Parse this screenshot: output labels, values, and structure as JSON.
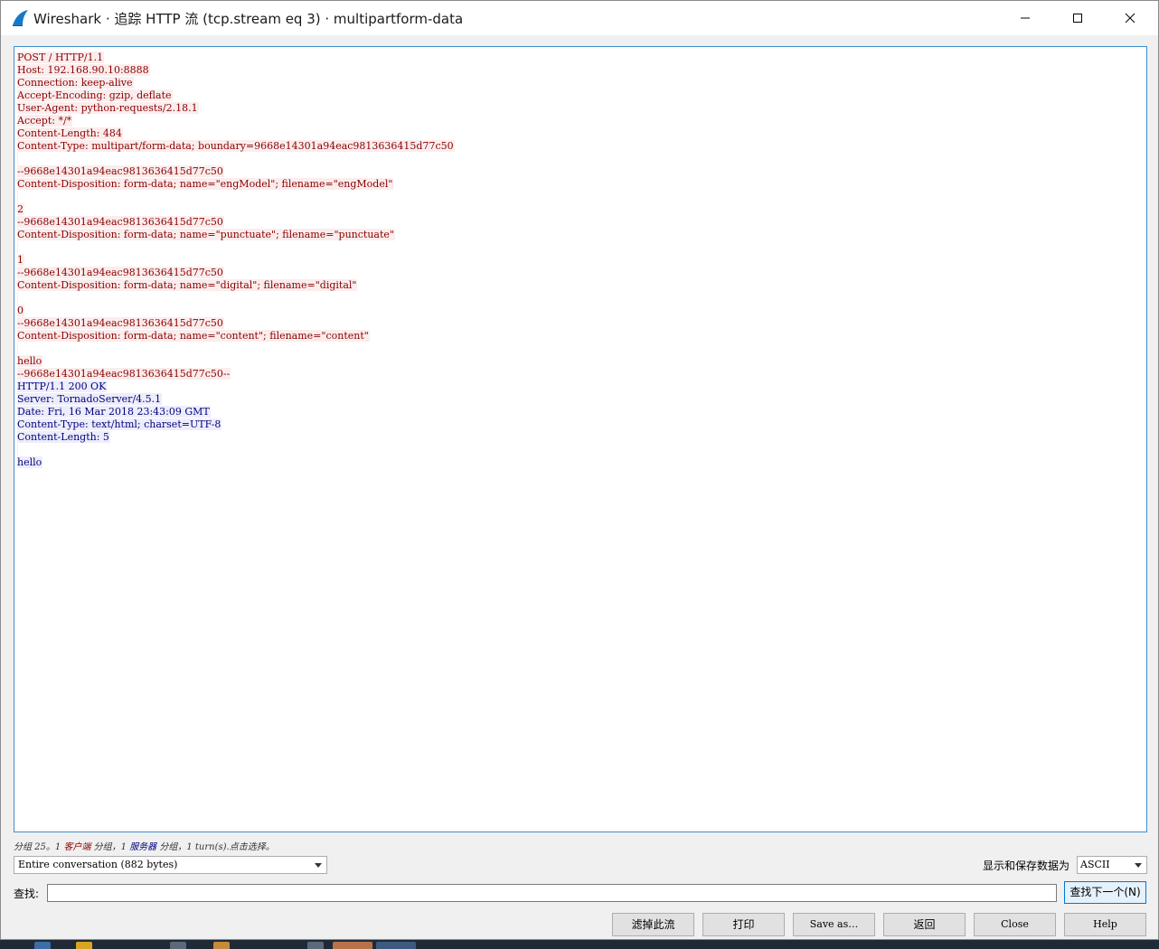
{
  "window": {
    "title": "Wireshark · 追踪 HTTP 流 (tcp.stream eq 3) · multipartform-data"
  },
  "icons": {
    "app": "wireshark-fin-icon",
    "minimize": "minimize-icon",
    "maximize": "maximize-icon",
    "close": "close-icon"
  },
  "colors": {
    "client_text": "#8b0000",
    "client_bg": "#fbeded",
    "server_text": "#000080",
    "server_bg": "#ededfb",
    "accent": "#0078d7"
  },
  "stream": {
    "lines": [
      {
        "text": "POST / HTTP/1.1",
        "side": "client"
      },
      {
        "text": "Host: 192.168.90.10:8888",
        "side": "client"
      },
      {
        "text": "Connection: keep-alive",
        "side": "client"
      },
      {
        "text": "Accept-Encoding: gzip, deflate",
        "side": "client"
      },
      {
        "text": "User-Agent: python-requests/2.18.1",
        "side": "client"
      },
      {
        "text": "Accept: */*",
        "side": "client"
      },
      {
        "text": "Content-Length: 484",
        "side": "client"
      },
      {
        "text": "Content-Type: multipart/form-data; boundary=9668e14301a94eac9813636415d77c50",
        "side": "client"
      },
      {
        "text": "",
        "side": "client"
      },
      {
        "text": "--9668e14301a94eac9813636415d77c50",
        "side": "client"
      },
      {
        "text": "Content-Disposition: form-data; name=\"engModel\"; filename=\"engModel\"",
        "side": "client"
      },
      {
        "text": "",
        "side": "client"
      },
      {
        "text": "2",
        "side": "client"
      },
      {
        "text": "--9668e14301a94eac9813636415d77c50",
        "side": "client"
      },
      {
        "text": "Content-Disposition: form-data; name=\"punctuate\"; filename=\"punctuate\"",
        "side": "client"
      },
      {
        "text": "",
        "side": "client"
      },
      {
        "text": "1",
        "side": "client"
      },
      {
        "text": "--9668e14301a94eac9813636415d77c50",
        "side": "client"
      },
      {
        "text": "Content-Disposition: form-data; name=\"digital\"; filename=\"digital\"",
        "side": "client"
      },
      {
        "text": "",
        "side": "client"
      },
      {
        "text": "0",
        "side": "client"
      },
      {
        "text": "--9668e14301a94eac9813636415d77c50",
        "side": "client"
      },
      {
        "text": "Content-Disposition: form-data; name=\"content\"; filename=\"content\"",
        "side": "client"
      },
      {
        "text": "",
        "side": "client"
      },
      {
        "text": "hello",
        "side": "client"
      },
      {
        "text": "--9668e14301a94eac9813636415d77c50--",
        "side": "client"
      },
      {
        "text": "HTTP/1.1 200 OK",
        "side": "server"
      },
      {
        "text": "Server: TornadoServer/4.5.1",
        "side": "server"
      },
      {
        "text": "Date: Fri, 16 Mar 2018 23:43:09 GMT",
        "side": "server"
      },
      {
        "text": "Content-Type: text/html; charset=UTF-8",
        "side": "server"
      },
      {
        "text": "Content-Length: 5",
        "side": "server"
      },
      {
        "text": "",
        "side": "server"
      },
      {
        "text": "hello",
        "side": "server"
      }
    ]
  },
  "summary": {
    "prefix": "分组 25。1 ",
    "client": "客户端",
    "mid": " 分组，1 ",
    "server": "服务器",
    "suffix": " 分组，1 turn(s).点击选择。"
  },
  "controls": {
    "conversation_selected": "Entire conversation (882 bytes)",
    "format_label": "显示和保存数据为",
    "format_selected": "ASCII",
    "find_label": "查找:",
    "find_value": "",
    "find_next": "查找下一个(N)"
  },
  "buttons": {
    "filter_out": "滤掉此流",
    "print": "打印",
    "save_as": "Save as…",
    "back": "返回",
    "close": "Close",
    "help": "Help"
  }
}
